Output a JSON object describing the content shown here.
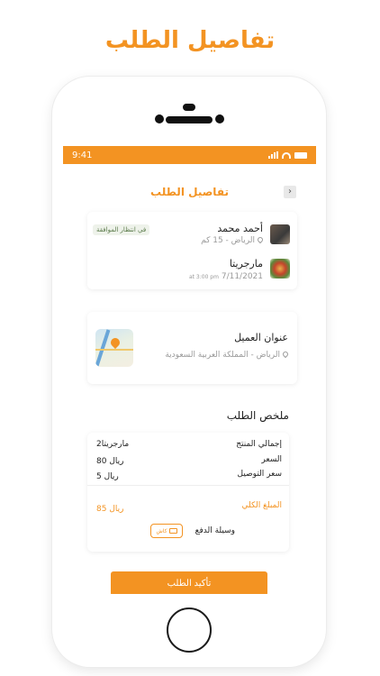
{
  "page": {
    "hero_title": "تفاصيل الطلب"
  },
  "status_bar": {
    "time": "9:41",
    "icons": [
      "signal-icon",
      "wifi-icon",
      "battery-icon"
    ]
  },
  "header": {
    "title": "تفاصيل الطلب",
    "back_icon": "›"
  },
  "order_card": {
    "customer_name": "أحمد محمد",
    "customer_location": "الرياض - 15 كم",
    "status_badge": "في انتظار الموافقة",
    "dish_name": "مارجريتا",
    "date": "7/11/2021",
    "time": "at 3:00 pm"
  },
  "address_card": {
    "title": "عنوان العميل",
    "address": "الرياض - المملكة العربية السعودية"
  },
  "summary": {
    "title": "ملخص الطلب",
    "rows": [
      {
        "label": "إجمالي المنتج",
        "value": "2مارجريتا"
      },
      {
        "label": "السعر",
        "value": "80 ريال"
      },
      {
        "label": "سعر التوصيل",
        "value": "5 ريال"
      }
    ],
    "total_label": "المبلغ الكلي",
    "total_value": "85 ريال",
    "payment_label": "وسيلة الدفع",
    "payment_method": "كاش"
  },
  "actions": {
    "confirm_label": "تأكيد الطلب"
  },
  "colors": {
    "accent": "#f39322"
  }
}
